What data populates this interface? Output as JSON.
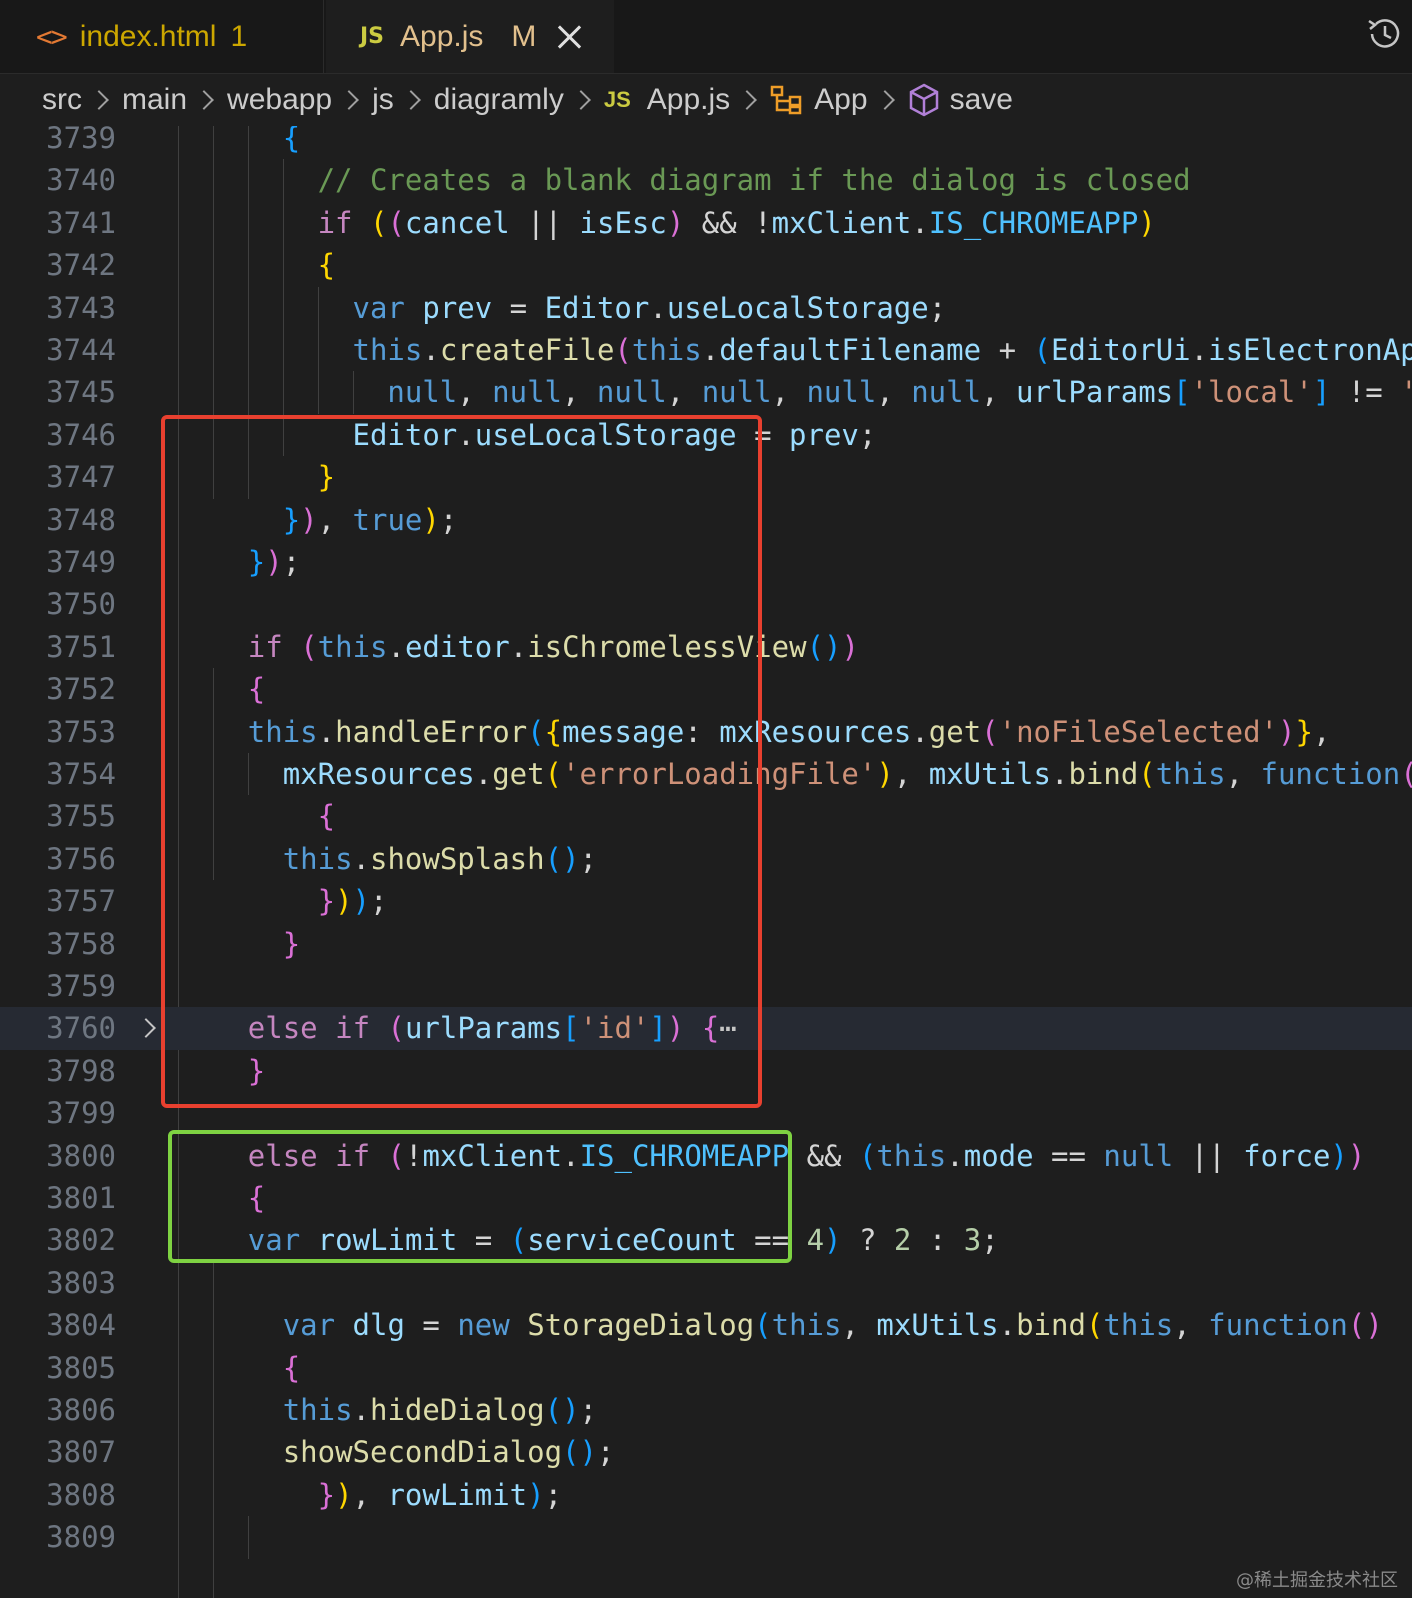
{
  "tabs": [
    {
      "icon": "<>",
      "name": "index.html",
      "badge": "1"
    },
    {
      "icon": "JS",
      "name": "App.js",
      "badge": "M"
    }
  ],
  "breadcrumbs": {
    "items": [
      "src",
      "main",
      "webapp",
      "js",
      "diagramly"
    ],
    "file_icon": "JS",
    "file": "App.js",
    "class_name": "App",
    "method_name": "save"
  },
  "editor": {
    "fold_ellipsis": "⋯",
    "lines": [
      {
        "num": "3739",
        "tokens": [
          [
            "b3",
            "{"
          ]
        ]
      },
      {
        "num": "3740",
        "tokens": [
          [
            "co",
            "// Creates a blank diagram if the dialog is closed"
          ]
        ]
      },
      {
        "num": "3741",
        "tokens": [
          [
            "kw",
            "if"
          ],
          [
            "op",
            " "
          ],
          [
            "b1",
            "("
          ],
          [
            "b2",
            "("
          ],
          [
            "vr",
            "cancel"
          ],
          [
            "op",
            " || "
          ],
          [
            "vr",
            "isEsc"
          ],
          [
            "b2",
            ")"
          ],
          [
            "op",
            " && !"
          ],
          [
            "vr",
            "mxClient"
          ],
          [
            "op",
            "."
          ],
          [
            "cn",
            "IS_CHROMEAPP"
          ],
          [
            "b1",
            ")"
          ]
        ]
      },
      {
        "num": "3742",
        "tokens": [
          [
            "b1",
            "{"
          ]
        ]
      },
      {
        "num": "3743",
        "tokens": [
          [
            "st",
            "var"
          ],
          [
            "op",
            " "
          ],
          [
            "vr",
            "prev"
          ],
          [
            "op",
            " = "
          ],
          [
            "vr",
            "Editor"
          ],
          [
            "op",
            "."
          ],
          [
            "vr",
            "useLocalStorage"
          ],
          [
            "op",
            ";"
          ]
        ]
      },
      {
        "num": "3744",
        "tokens": [
          [
            "st",
            "this"
          ],
          [
            "op",
            "."
          ],
          [
            "fn",
            "createFile"
          ],
          [
            "b2",
            "("
          ],
          [
            "st",
            "this"
          ],
          [
            "op",
            "."
          ],
          [
            "vr",
            "defaultFilename"
          ],
          [
            "op",
            " + "
          ],
          [
            "b3",
            "("
          ],
          [
            "vr",
            "EditorUi"
          ],
          [
            "op",
            "."
          ],
          [
            "vr",
            "isElectronApp"
          ]
        ]
      },
      {
        "num": "3745",
        "tokens": [
          [
            "st",
            "null"
          ],
          [
            "op",
            ", "
          ],
          [
            "st",
            "null"
          ],
          [
            "op",
            ", "
          ],
          [
            "st",
            "null"
          ],
          [
            "op",
            ", "
          ],
          [
            "st",
            "null"
          ],
          [
            "op",
            ", "
          ],
          [
            "st",
            "null"
          ],
          [
            "op",
            ", "
          ],
          [
            "st",
            "null"
          ],
          [
            "op",
            ", "
          ],
          [
            "vr",
            "urlParams"
          ],
          [
            "b3",
            "["
          ],
          [
            "sg",
            "'local'"
          ],
          [
            "b3",
            "]"
          ],
          [
            "op",
            " != "
          ],
          [
            "sg",
            "'"
          ]
        ]
      },
      {
        "num": "3746",
        "tokens": [
          [
            "vr",
            "Editor"
          ],
          [
            "op",
            "."
          ],
          [
            "vr",
            "useLocalStorage"
          ],
          [
            "op",
            " = "
          ],
          [
            "vr",
            "prev"
          ],
          [
            "op",
            ";"
          ]
        ]
      },
      {
        "num": "3747",
        "tokens": [
          [
            "b1",
            "}"
          ]
        ]
      },
      {
        "num": "3748",
        "tokens": [
          [
            "b3",
            "}"
          ],
          [
            "b2",
            ")"
          ],
          [
            "op",
            ", "
          ],
          [
            "st",
            "true"
          ],
          [
            "b1",
            ")"
          ],
          [
            "op",
            ";"
          ]
        ]
      },
      {
        "num": "3749",
        "tokens": [
          [
            "b3",
            "}"
          ],
          [
            "b2",
            ")"
          ],
          [
            "op",
            ";"
          ]
        ]
      },
      {
        "num": "3750",
        "tokens": []
      },
      {
        "num": "3751",
        "tokens": [
          [
            "kw",
            "if"
          ],
          [
            "op",
            " "
          ],
          [
            "b2",
            "("
          ],
          [
            "st",
            "this"
          ],
          [
            "op",
            "."
          ],
          [
            "vr",
            "editor"
          ],
          [
            "op",
            "."
          ],
          [
            "fn",
            "isChromelessView"
          ],
          [
            "b3",
            "()"
          ],
          [
            "b2",
            ")"
          ]
        ]
      },
      {
        "num": "3752",
        "tokens": [
          [
            "b2",
            "{"
          ]
        ]
      },
      {
        "num": "3753",
        "tokens": [
          [
            "st",
            "this"
          ],
          [
            "op",
            "."
          ],
          [
            "fn",
            "handleError"
          ],
          [
            "b3",
            "("
          ],
          [
            "b1",
            "{"
          ],
          [
            "vr",
            "message"
          ],
          [
            "op",
            ": "
          ],
          [
            "vr",
            "mxResources"
          ],
          [
            "op",
            "."
          ],
          [
            "fn",
            "get"
          ],
          [
            "b2",
            "("
          ],
          [
            "sg",
            "'noFileSelected'"
          ],
          [
            "b2",
            ")"
          ],
          [
            "b1",
            "}"
          ],
          [
            "op",
            ","
          ]
        ]
      },
      {
        "num": "3754",
        "tokens": [
          [
            "vr",
            "mxResources"
          ],
          [
            "op",
            "."
          ],
          [
            "fn",
            "get"
          ],
          [
            "b1",
            "("
          ],
          [
            "sg",
            "'errorLoadingFile'"
          ],
          [
            "b1",
            ")"
          ],
          [
            "op",
            ", "
          ],
          [
            "vr",
            "mxUtils"
          ],
          [
            "op",
            "."
          ],
          [
            "fn",
            "bind"
          ],
          [
            "b1",
            "("
          ],
          [
            "st",
            "this"
          ],
          [
            "op",
            ", "
          ],
          [
            "st",
            "function"
          ],
          [
            "b2",
            "("
          ]
        ]
      },
      {
        "num": "3755",
        "tokens": [
          [
            "b2",
            "{"
          ]
        ]
      },
      {
        "num": "3756",
        "tokens": [
          [
            "st",
            "this"
          ],
          [
            "op",
            "."
          ],
          [
            "fn",
            "showSplash"
          ],
          [
            "b3",
            "()"
          ],
          [
            "op",
            ";"
          ]
        ]
      },
      {
        "num": "3757",
        "tokens": [
          [
            "b2",
            "}"
          ],
          [
            "b1",
            ")"
          ],
          [
            "b3",
            ")"
          ],
          [
            "op",
            ";"
          ]
        ]
      },
      {
        "num": "3758",
        "tokens": [
          [
            "b2",
            "}"
          ]
        ]
      },
      {
        "num": "3759",
        "tokens": []
      },
      {
        "num": "3760",
        "tokens": [
          [
            "kw",
            "else"
          ],
          [
            "op",
            " "
          ],
          [
            "kw",
            "if"
          ],
          [
            "op",
            " "
          ],
          [
            "b2",
            "("
          ],
          [
            "vr",
            "urlParams"
          ],
          [
            "b3",
            "["
          ],
          [
            "sg",
            "'id'"
          ],
          [
            "b3",
            "]"
          ],
          [
            "b2",
            ")"
          ],
          [
            "op",
            " "
          ],
          [
            "b2",
            "{"
          ]
        ]
      },
      {
        "num": "3798",
        "tokens": [
          [
            "b2",
            "}"
          ]
        ]
      },
      {
        "num": "3799",
        "tokens": []
      },
      {
        "num": "3800",
        "tokens": [
          [
            "kw",
            "else"
          ],
          [
            "op",
            " "
          ],
          [
            "kw",
            "if"
          ],
          [
            "op",
            " "
          ],
          [
            "b2",
            "("
          ],
          [
            "op",
            "!"
          ],
          [
            "vr",
            "mxClient"
          ],
          [
            "op",
            "."
          ],
          [
            "cn",
            "IS_CHROMEAPP"
          ],
          [
            "op",
            " && "
          ],
          [
            "b3",
            "("
          ],
          [
            "st",
            "this"
          ],
          [
            "op",
            "."
          ],
          [
            "vr",
            "mode"
          ],
          [
            "op",
            " == "
          ],
          [
            "st",
            "null"
          ],
          [
            "op",
            " || "
          ],
          [
            "vr",
            "force"
          ],
          [
            "b3",
            ")"
          ],
          [
            "b2",
            ")"
          ]
        ]
      },
      {
        "num": "3801",
        "tokens": [
          [
            "b2",
            "{"
          ]
        ]
      },
      {
        "num": "3802",
        "tokens": [
          [
            "st",
            "var"
          ],
          [
            "op",
            " "
          ],
          [
            "vr",
            "rowLimit"
          ],
          [
            "op",
            " = "
          ],
          [
            "b3",
            "("
          ],
          [
            "vr",
            "serviceCount"
          ],
          [
            "op",
            " == "
          ],
          [
            "nu",
            "4"
          ],
          [
            "b3",
            ")"
          ],
          [
            "op",
            " ? "
          ],
          [
            "nu",
            "2"
          ],
          [
            "op",
            " : "
          ],
          [
            "nu",
            "3"
          ],
          [
            "op",
            ";"
          ]
        ]
      },
      {
        "num": "3803",
        "tokens": []
      },
      {
        "num": "3804",
        "tokens": [
          [
            "st",
            "var"
          ],
          [
            "op",
            " "
          ],
          [
            "vr",
            "dlg"
          ],
          [
            "op",
            " = "
          ],
          [
            "st",
            "new"
          ],
          [
            "op",
            " "
          ],
          [
            "fn",
            "StorageDialog"
          ],
          [
            "b3",
            "("
          ],
          [
            "st",
            "this"
          ],
          [
            "op",
            ", "
          ],
          [
            "vr",
            "mxUtils"
          ],
          [
            "op",
            "."
          ],
          [
            "fn",
            "bind"
          ],
          [
            "b1",
            "("
          ],
          [
            "st",
            "this"
          ],
          [
            "op",
            ", "
          ],
          [
            "st",
            "function"
          ],
          [
            "b2",
            "()"
          ]
        ]
      },
      {
        "num": "3805",
        "tokens": [
          [
            "b2",
            "{"
          ]
        ]
      },
      {
        "num": "3806",
        "tokens": [
          [
            "st",
            "this"
          ],
          [
            "op",
            "."
          ],
          [
            "fn",
            "hideDialog"
          ],
          [
            "b3",
            "()"
          ],
          [
            "op",
            ";"
          ]
        ]
      },
      {
        "num": "3807",
        "tokens": [
          [
            "fn",
            "showSecondDialog"
          ],
          [
            "b3",
            "()"
          ],
          [
            "op",
            ";"
          ]
        ]
      },
      {
        "num": "3808",
        "tokens": [
          [
            "b2",
            "}"
          ],
          [
            "b1",
            ")"
          ],
          [
            "op",
            ", "
          ],
          [
            "vr",
            "rowLimit"
          ],
          [
            "b3",
            ")"
          ],
          [
            "op",
            ";"
          ]
        ]
      },
      {
        "num": "3809",
        "tokens": []
      }
    ]
  },
  "watermark": "@稀土掘金技术社区"
}
